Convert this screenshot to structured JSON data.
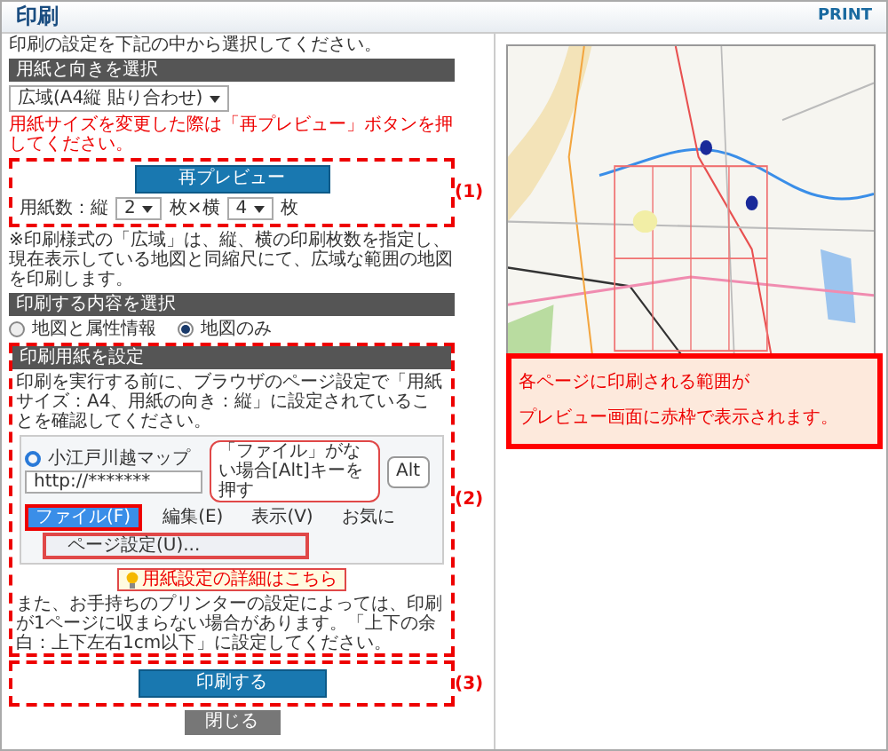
{
  "header": {
    "title": "印刷",
    "print_label": "PRINT"
  },
  "intro": "印刷の設定を下記の中から選択してください。",
  "paper": {
    "heading": "用紙と向きを選択",
    "select_value": "広域(A4縦 貼り合わせ)",
    "note": "用紙サイズを変更した際は「再プレビュー」ボタンを押してください。",
    "step": "(1)",
    "preview_button": "再プレビュー",
    "count_label": "用紙数：縦",
    "rows": "2",
    "times": "枚×横",
    "cols": "4",
    "unit": "枚"
  },
  "scope_note": "※印刷様式の「広域」は、縦、横の印刷枚数を指定し、現在表示している地図と同縮尺にて、広域な範囲の地図を印刷します。",
  "content": {
    "heading": "印刷する内容を選択",
    "options": [
      {
        "label": "地図と属性情報",
        "selected": false
      },
      {
        "label": "地図のみ",
        "selected": true
      }
    ]
  },
  "page_setup": {
    "step": "(2)",
    "heading": "印刷用紙を設定",
    "text": "印刷を実行する前に、ブラウザのページ設定で「用紙サイズ：A4、用紙の向き：縦」に設定されていることを確認してください。",
    "browser": {
      "tab": "小江戸川越マップ",
      "address": "http://*******",
      "callout": "「ファイル」がない場合[Alt]キーを押す",
      "key": "Alt",
      "menus": [
        {
          "label": "ファイル(F)",
          "selected": true
        },
        {
          "label": "編集(E)",
          "selected": false
        },
        {
          "label": "表示(V)",
          "selected": false
        },
        {
          "label": "お気に",
          "selected": false
        }
      ],
      "menu_item": "ページ設定(U)..."
    },
    "link": "用紙設定の詳細はこちら",
    "note": "また、お手持ちのプリンターの設定によっては、印刷が1ページに収まらない場合があります。「上下の余白：上下左右1cm以下」に設定してください。"
  },
  "print": {
    "step": "(3)",
    "button": "印刷する"
  },
  "close_button": "閉じる",
  "callout": [
    "各ページに印刷される範囲が",
    "プレビュー画面に赤枠で表示されます。"
  ]
}
